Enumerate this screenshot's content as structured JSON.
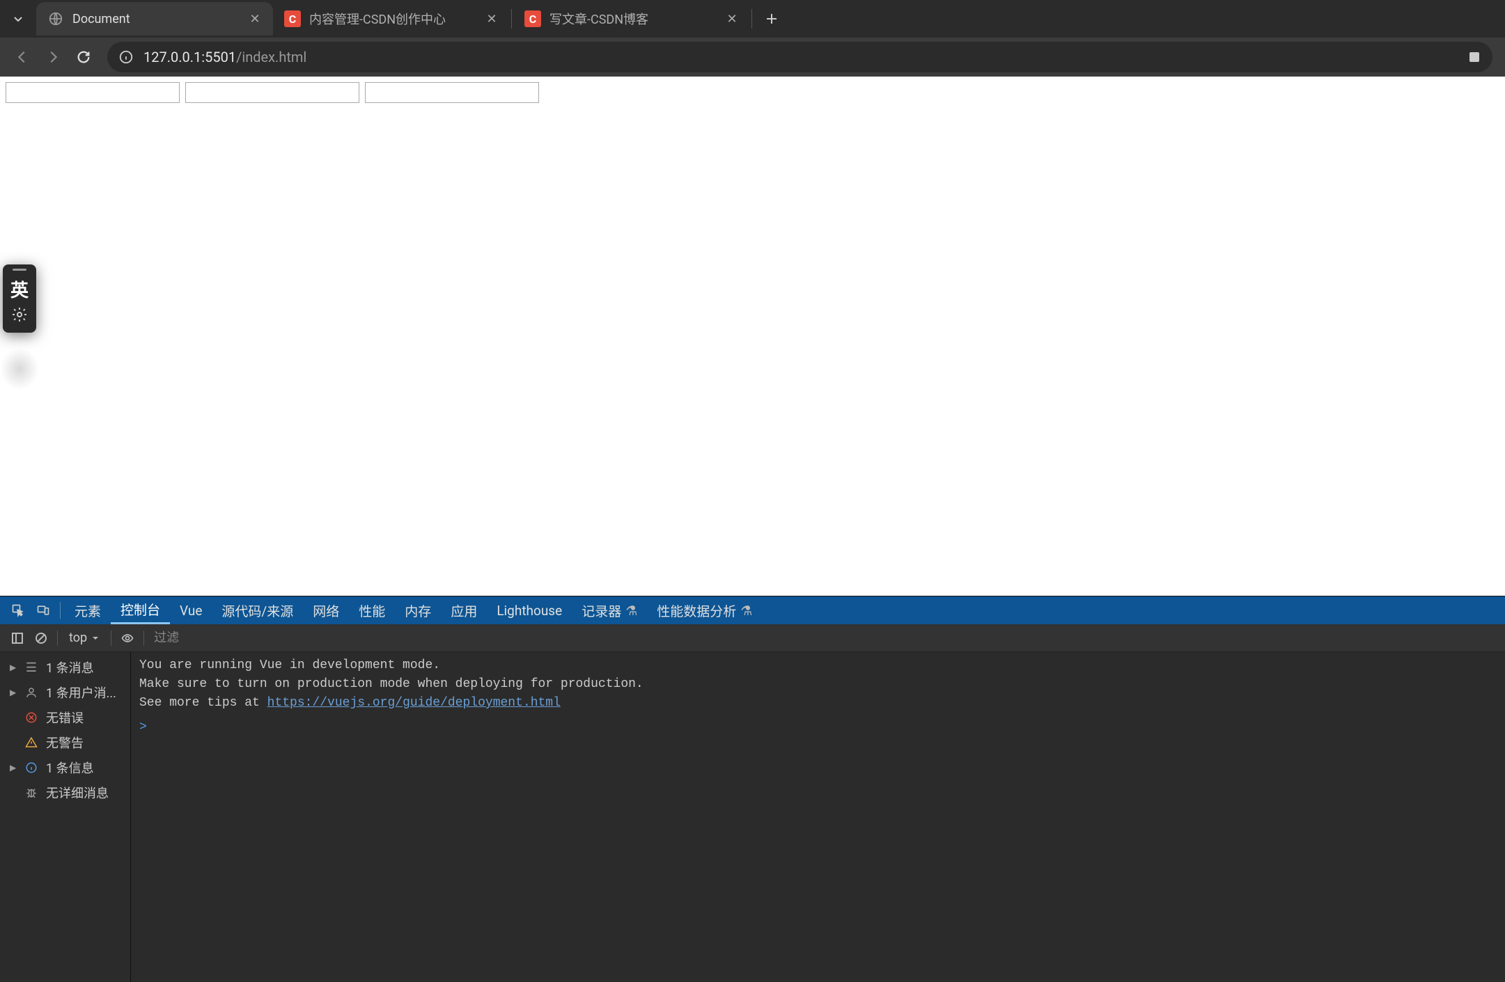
{
  "tabs": [
    {
      "title": "Document",
      "favicon": "globe",
      "active": true
    },
    {
      "title": "内容管理-CSDN创作中心",
      "favicon": "C",
      "active": false
    },
    {
      "title": "写文章-CSDN博客",
      "favicon": "C",
      "active": false
    }
  ],
  "address": {
    "host": "127.0.0.1:5501",
    "path": "/index.html"
  },
  "ime": {
    "char": "英"
  },
  "devtools": {
    "tabs": [
      "元素",
      "控制台",
      "Vue",
      "源代码/来源",
      "网络",
      "性能",
      "内存",
      "应用",
      "Lighthouse",
      "记录器",
      "性能数据分析"
    ],
    "activeTab": "控制台",
    "toolbar": {
      "context": "top",
      "filterPlaceholder": "过滤"
    },
    "sidebar": [
      {
        "arrow": true,
        "icon": "list",
        "label": "1 条消息"
      },
      {
        "arrow": true,
        "icon": "user",
        "label": "1 条用户消..."
      },
      {
        "arrow": false,
        "icon": "error",
        "label": "无错误"
      },
      {
        "arrow": false,
        "icon": "warning",
        "label": "无警告"
      },
      {
        "arrow": true,
        "icon": "info",
        "label": "1 条信息"
      },
      {
        "arrow": false,
        "icon": "bug",
        "label": "无详细消息"
      }
    ],
    "console": {
      "line1": "You are running Vue in development mode.",
      "line2": "Make sure to turn on production mode when deploying for production.",
      "line3_prefix": "See more tips at ",
      "line3_link": "https://vuejs.org/guide/deployment.html",
      "prompt": ">"
    }
  }
}
